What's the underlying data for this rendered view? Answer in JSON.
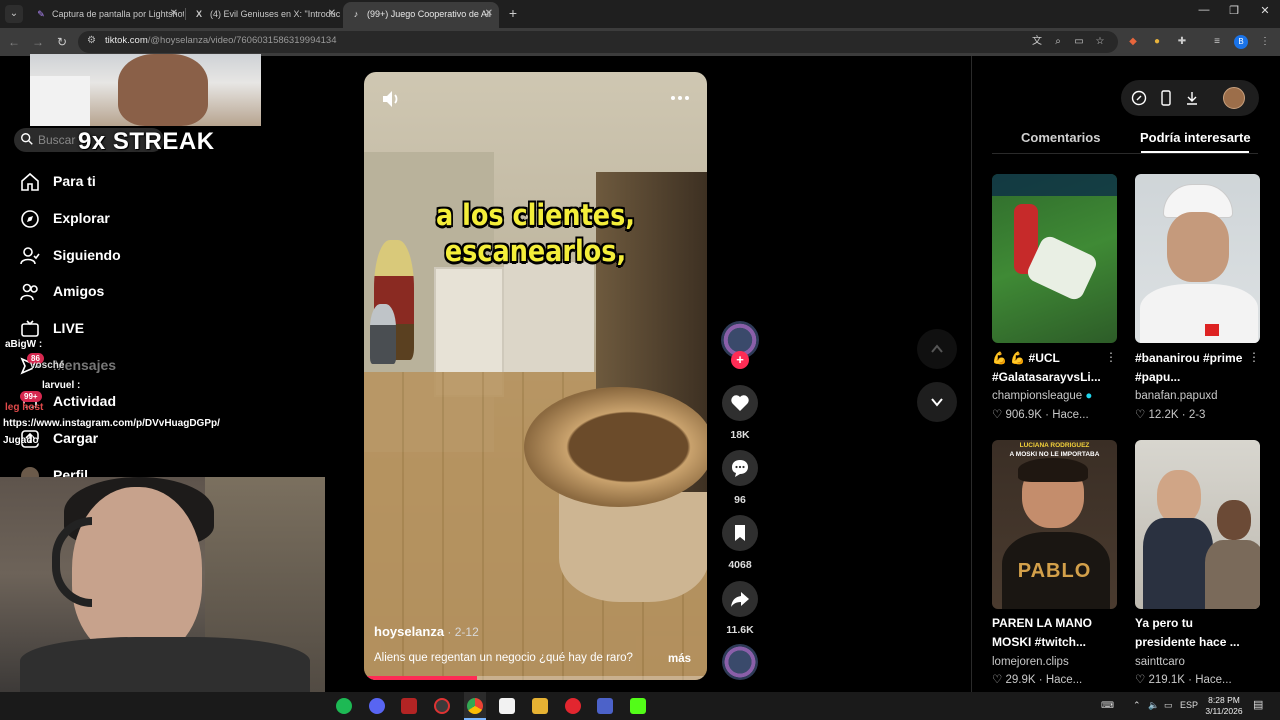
{
  "browser": {
    "tabs": [
      {
        "title": "Captura de pantalla por Lightshot",
        "active": false,
        "icon": "lightshot-icon"
      },
      {
        "title": "(4) Evil Geniuses en X: \"Introduc",
        "active": false,
        "icon": "x-icon"
      },
      {
        "title": "(99+) Juego Cooperativo de Ali",
        "active": true,
        "icon": "tiktok-icon"
      }
    ],
    "url_host": "tiktok.com",
    "url_path": "/@hoyselanza/video/7606031586319994134",
    "profile_initial": "B"
  },
  "overlay": {
    "streak_text": "9x STREAK",
    "chat": [
      {
        "user": "aBigW :",
        "badge": "86"
      },
      {
        "user": "vosché",
        "badge": ""
      },
      {
        "user": "larvuel :",
        "badge": "99+"
      },
      {
        "user": "leg host",
        "badge": ""
      }
    ],
    "link_text": "https://www.instagram.com/p/DVvHuagDGPp/",
    "jugando_text": "Jugado"
  },
  "sidebar": {
    "search_placeholder": "Buscar",
    "items": [
      {
        "label": "Para ti",
        "icon": "home-icon"
      },
      {
        "label": "Explorar",
        "icon": "compass-icon"
      },
      {
        "label": "Siguiendo",
        "icon": "following-icon"
      },
      {
        "label": "Amigos",
        "icon": "friends-icon"
      },
      {
        "label": "LIVE",
        "icon": "live-icon"
      },
      {
        "label": "Mensajes",
        "icon": "message-icon"
      },
      {
        "label": "Actividad",
        "icon": "activity-icon"
      },
      {
        "label": "Cargar",
        "icon": "upload-icon"
      },
      {
        "label": "Perfil",
        "icon": "profile-icon"
      }
    ]
  },
  "video": {
    "caption_line1": "a los clientes,",
    "caption_line2": "escanearlos,",
    "author": "hoyselanza",
    "date": " · 2-12",
    "description": "Aliens que regentan un negocio ¿qué hay de raro?",
    "more_label": "más",
    "progress": 0.33
  },
  "actions": {
    "likes": "18K",
    "comments": "96",
    "saves": "4068",
    "shares": "11.6K"
  },
  "right_panel": {
    "tabs": [
      "Comentarios",
      "Podría interesarte"
    ],
    "active_tab": 1,
    "cards": [
      {
        "title": "💪 💪 #UCL #GalatasarayvsLi...",
        "user": "championsleague",
        "verified": true,
        "views": "906.9K",
        "time": "Hace..."
      },
      {
        "title": "#bananirou #prime #papu...",
        "user": "banafan.papuxd",
        "verified": false,
        "views": "12.2K",
        "time": "2-3"
      },
      {
        "title": "PAREN LA MANO MOSKI #twitch...",
        "user": "lomejoren.clips",
        "verified": false,
        "views": "29.9K",
        "time": "Hace..."
      },
      {
        "title": "Ya pero tu presidente hace ...",
        "user": "sainttcaro",
        "verified": false,
        "views": "219.1K",
        "time": "Hace..."
      }
    ],
    "thumb3_text_top": "LUCIANA RODRIGUEZ",
    "thumb3_text_sub": "A MOSKI NO LE IMPORTABA",
    "thumb3_shirt": "PABLO"
  },
  "taskbar": {
    "language": "ESP",
    "time": "8:28 PM",
    "date": "3/11/2026"
  },
  "colors": {
    "tiktok_red": "#fe2c55",
    "caption_yellow": "#f4ee3a"
  }
}
